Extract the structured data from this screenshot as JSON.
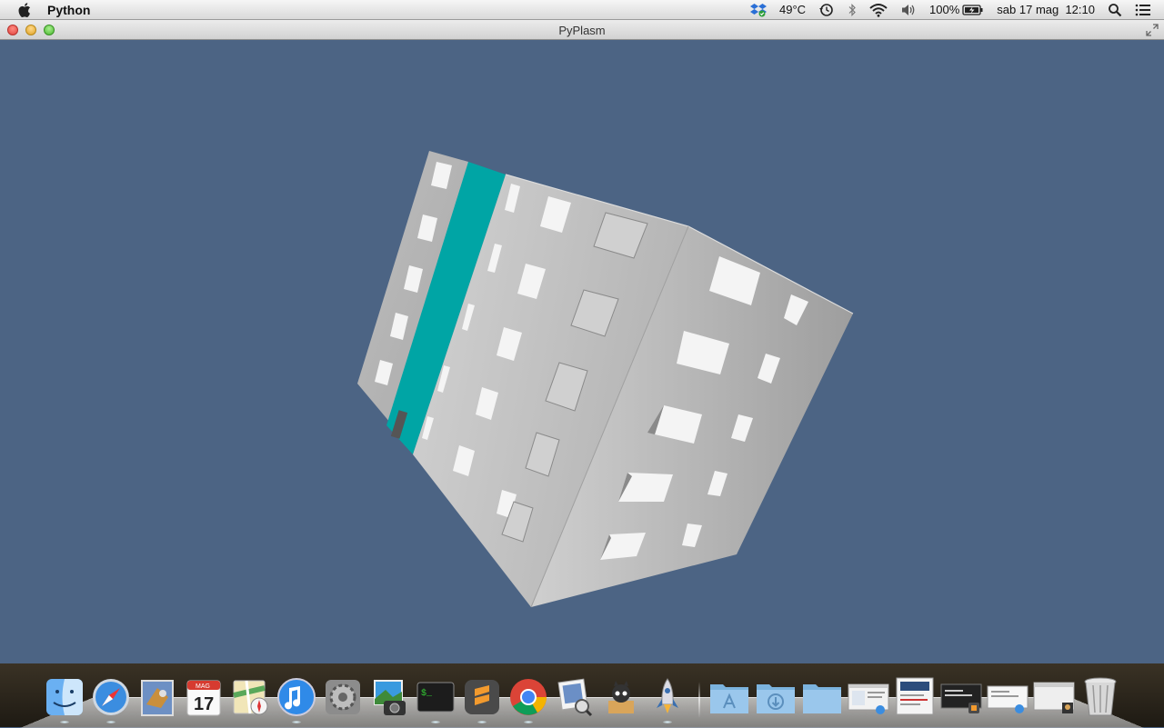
{
  "menubar": {
    "app_name": "Python",
    "temperature": "49°C",
    "battery": "100%",
    "datetime": "sab 17 mag  12:10"
  },
  "window": {
    "title": "PyPlasm"
  },
  "colors": {
    "canvas_bg": "#4c6484",
    "teal_stripe": "#00a5a5",
    "building_gray": "#c8c8c8"
  },
  "dock": {
    "items": [
      {
        "name": "finder-icon",
        "running": true
      },
      {
        "name": "safari-icon",
        "running": true
      },
      {
        "name": "mail-icon",
        "running": false
      },
      {
        "name": "calendar-icon",
        "running": false,
        "label_month": "MAG",
        "label_day": "17"
      },
      {
        "name": "maps-icon",
        "running": false
      },
      {
        "name": "itunes-icon",
        "running": true
      },
      {
        "name": "system-preferences-icon",
        "running": false
      },
      {
        "name": "image-capture-icon",
        "running": false
      },
      {
        "name": "terminal-icon",
        "running": true
      },
      {
        "name": "sublime-text-icon",
        "running": true
      },
      {
        "name": "chrome-icon",
        "running": true
      },
      {
        "name": "preview-icon",
        "running": false
      },
      {
        "name": "github-icon",
        "running": false
      },
      {
        "name": "python-rocket-icon",
        "running": true
      }
    ],
    "stacks": [
      {
        "name": "applications-folder-icon"
      },
      {
        "name": "downloads-folder-icon"
      },
      {
        "name": "documents-folder-icon"
      },
      {
        "name": "minimized-window-1-icon"
      },
      {
        "name": "minimized-window-2-icon"
      },
      {
        "name": "minimized-window-3-icon"
      },
      {
        "name": "minimized-window-4-icon"
      },
      {
        "name": "minimized-window-5-icon"
      },
      {
        "name": "trash-icon"
      }
    ]
  }
}
